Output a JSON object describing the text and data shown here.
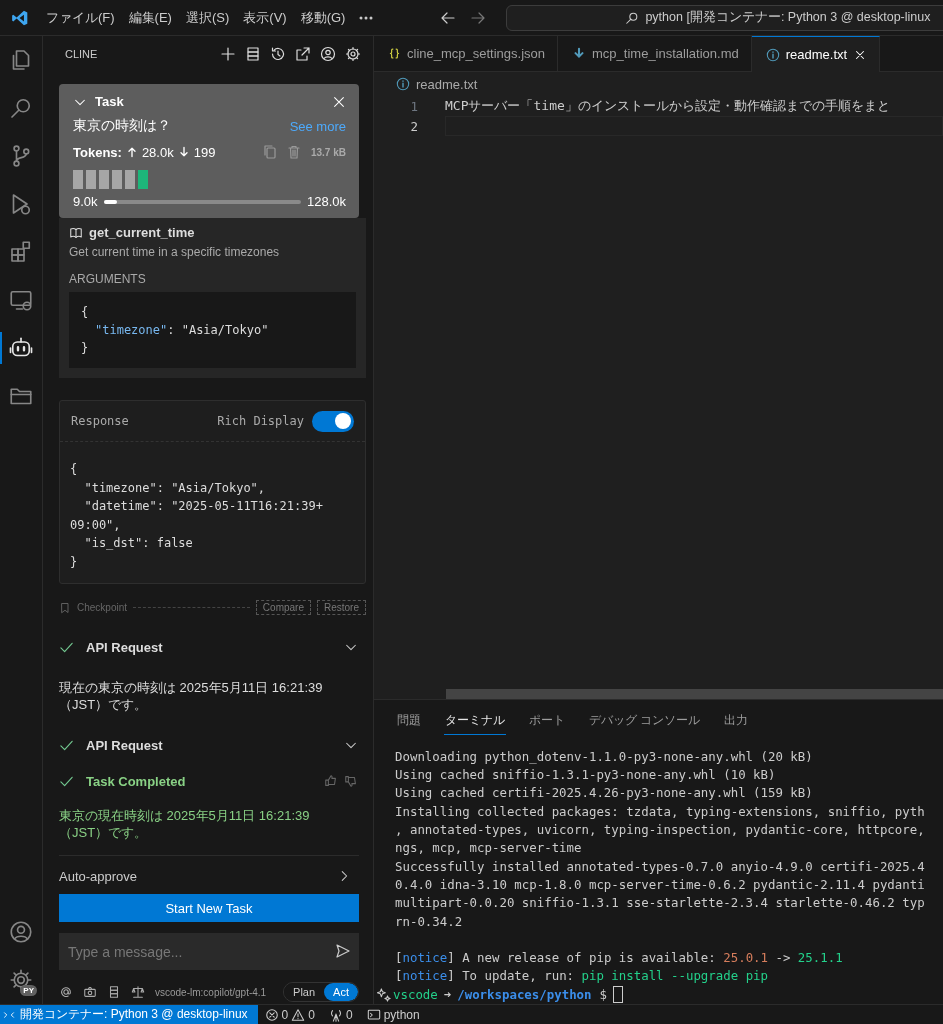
{
  "title_bar": {
    "menu": [
      "ファイル(F)",
      "編集(E)",
      "選択(S)",
      "表示(V)",
      "移動(G)"
    ],
    "search": "python [開発コンテナー: Python 3 @ desktop-linux"
  },
  "activity_bar": [
    {
      "kind": "files",
      "selected": false
    },
    {
      "kind": "search",
      "selected": false
    },
    {
      "kind": "source_control",
      "selected": false
    },
    {
      "kind": "debug",
      "selected": false
    },
    {
      "kind": "extensions",
      "selected": false
    },
    {
      "kind": "remote",
      "selected": false
    },
    {
      "kind": "robot",
      "selected": true
    },
    {
      "kind": "folder",
      "selected": false
    },
    {
      "kind": "account",
      "selected": false
    },
    {
      "kind": "settings",
      "selected": false,
      "badge": "PY"
    }
  ],
  "sidebar": {
    "title": "CLINE",
    "task": {
      "title": "Task",
      "question": "東京の時刻は？",
      "see_more": "See more",
      "tokens_label": "Tokens:",
      "tokens_up": "28.0k",
      "tokens_down": "199",
      "size": "13.7 kB",
      "segments": [
        {
          "color": "#a6a6a6"
        },
        {
          "color": "#a6a6a6"
        },
        {
          "color": "#a6a6a6"
        },
        {
          "color": "#a6a6a6"
        },
        {
          "color": "#a6a6a6"
        },
        {
          "color": "#1db67a"
        }
      ],
      "context": {
        "used": "9.0k",
        "total": "128.0k",
        "level": 0.07
      }
    },
    "tool": {
      "name": "get_current_time",
      "description": "Get current time in a specific timezones",
      "args_label": "ARGUMENTS",
      "args": [
        {
          "text": "{"
        },
        {
          "key": "\"timezone\"",
          "rest": ": \"Asia/Tokyo\""
        },
        {
          "text": "}"
        }
      ]
    },
    "response": {
      "title": "Response",
      "rich_display": {
        "label": "Rich Display",
        "on": true
      },
      "lines": [
        "{",
        "  \"timezone\": \"Asia/Tokyo\",",
        "  \"datetime\": \"2025-05-11T16:21:39+",
        "09:00\",",
        "  \"is_dst\": false",
        "}"
      ]
    },
    "checkpoint": {
      "label": "Checkpoint",
      "buttons": [
        "Compare",
        "Restore"
      ]
    },
    "messages": [
      {
        "kind": "api_request",
        "label": "API Request"
      },
      {
        "kind": "text",
        "text": "現在の東京の時刻は 2025年5月11日 16:21:39（JST）です。"
      },
      {
        "kind": "api_request",
        "label": "API Request"
      },
      {
        "kind": "completed",
        "label": "Task Completed"
      },
      {
        "kind": "result",
        "text": "東京の現在時刻は 2025年5月11日 16:21:39（JST）です。"
      }
    ],
    "auto_approve": "Auto-approve",
    "start_button": "Start New Task",
    "input_placeholder": "Type a message...",
    "model": "vscode-lm:copilot/gpt-4.1",
    "modes": [
      {
        "label": "Plan",
        "selected": false
      },
      {
        "label": "Act",
        "selected": true
      }
    ]
  },
  "editor": {
    "tabs": [
      {
        "label": "cline_mcp_settings.json",
        "kind": "json",
        "selected": false
      },
      {
        "label": "mcp_time_installation.md",
        "kind": "markdown",
        "selected": false
      },
      {
        "label": "readme.txt",
        "kind": "info",
        "selected": true
      }
    ],
    "breadcrumb": "readme.txt",
    "lines": [
      {
        "number": "1",
        "text": "MCPサーバー「time」のインストールから設定・動作確認までの手順をまと",
        "current": false
      },
      {
        "number": "2",
        "current": true
      }
    ]
  },
  "panel": {
    "tabs": [
      {
        "label": "問題",
        "selected": false
      },
      {
        "label": "ターミナル",
        "selected": true
      },
      {
        "label": "ポート",
        "selected": false
      },
      {
        "label": "デバッグ コンソール",
        "selected": false
      },
      {
        "label": "出力",
        "selected": false
      }
    ],
    "terminal": [
      {
        "segments": [
          {
            "text": "Downloading python_dotenv-1.1.0-py3-none-any.whl (20 kB)"
          }
        ]
      },
      {
        "segments": [
          {
            "text": "Using cached sniffio-1.3.1-py3-none-any.whl (10 kB)"
          }
        ]
      },
      {
        "segments": [
          {
            "text": "Using cached certifi-2025.4.26-py3-none-any.whl (159 kB)"
          }
        ]
      },
      {
        "segments": [
          {
            "text": "Installing collected packages: tzdata, typing-extensions, sniffio, pyth"
          }
        ]
      },
      {
        "segments": [
          {
            "text": ", annotated-types, uvicorn, typing-inspection, pydantic-core, httpcore,"
          }
        ]
      },
      {
        "segments": [
          {
            "text": "ngs, mcp, mcp-server-time"
          }
        ]
      },
      {
        "segments": [
          {
            "text": "Successfully installed annotated-types-0.7.0 anyio-4.9.0 certifi-2025.4"
          }
        ]
      },
      {
        "segments": [
          {
            "text": "0.4.0 idna-3.10 mcp-1.8.0 mcp-server-time-0.6.2 pydantic-2.11.4 pydanti"
          }
        ]
      },
      {
        "segments": [
          {
            "text": "multipart-0.0.20 sniffio-1.3.1 sse-starlette-2.3.4 starlette-0.46.2 typ"
          }
        ]
      },
      {
        "segments": [
          {
            "text": "rn-0.34.2"
          }
        ]
      },
      {
        "kind": "blank"
      },
      {
        "segments": [
          {
            "text": "["
          },
          {
            "text": "notice",
            "kind": "tag"
          },
          {
            "text": "] A new release of pip is available: "
          },
          {
            "text": "25.0.1",
            "kind": "old"
          },
          {
            "text": " -> "
          },
          {
            "text": "25.1.1",
            "kind": "new"
          }
        ]
      },
      {
        "segments": [
          {
            "text": "["
          },
          {
            "text": "notice",
            "kind": "tag"
          },
          {
            "text": "] To update, run: "
          },
          {
            "text": "pip install --upgrade pip",
            "kind": "new"
          }
        ]
      },
      {
        "kind": "prompt",
        "user": "vscode",
        "arrow": "➜",
        "path": "/workspaces/python",
        "symbol": "$"
      }
    ]
  },
  "status_bar": {
    "remote": "開発コンテナー: Python 3 @ desktop-linux",
    "errors": "0",
    "warnings": "0",
    "ports": "0",
    "terminal": "python"
  }
}
